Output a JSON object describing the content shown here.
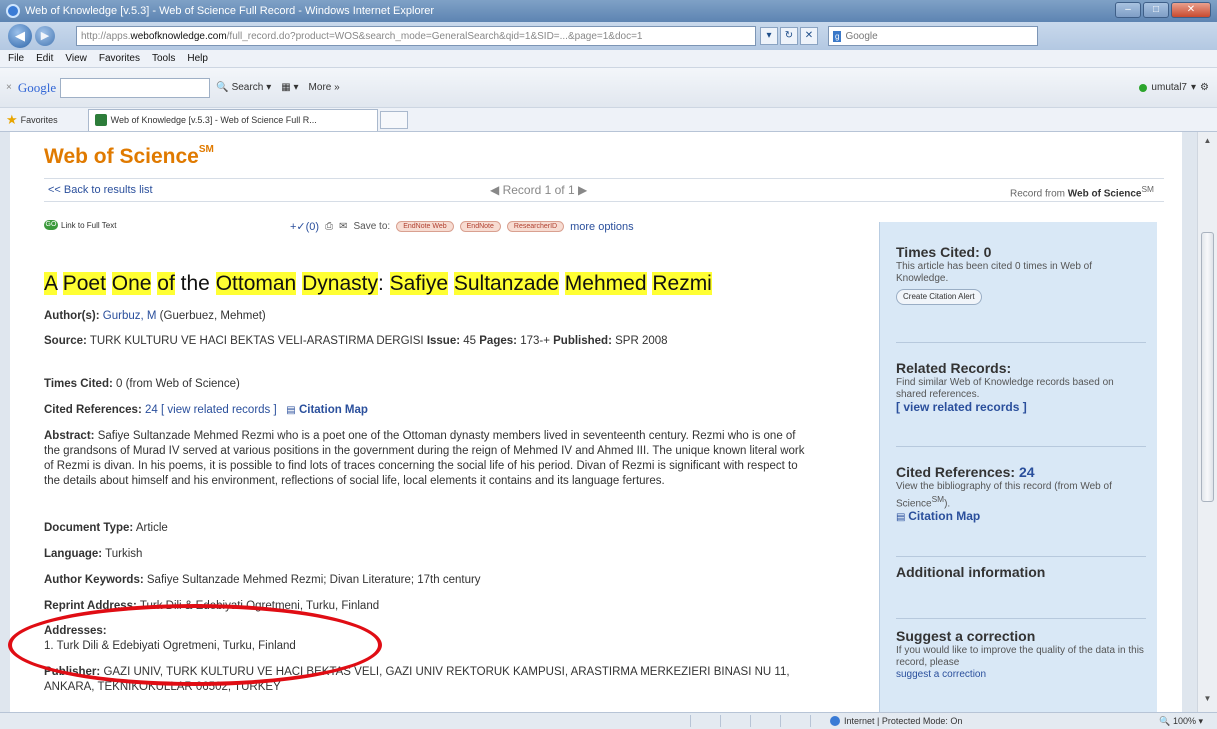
{
  "window": {
    "title": "Web of Knowledge [v.5.3] - Web of Science Full Record - Windows Internet Explorer"
  },
  "addressbar": {
    "url_prefix": "http://apps.",
    "url_domain": "webofknowledge.com",
    "url_rest": "/full_record.do?product=WOS&search_mode=GeneralSearch&qid=1&SID=...&page=1&doc=1",
    "search_engine": "Google"
  },
  "menu": [
    "File",
    "Edit",
    "View",
    "Favorites",
    "Tools",
    "Help"
  ],
  "google_toolbar": {
    "close": "×",
    "label": "Google",
    "search_label": "Search",
    "more_label": "More »",
    "user": "umutal7"
  },
  "favorites": {
    "label": "Favorites",
    "tab_title": "Web of Knowledge [v.5.3] - Web of Science Full R..."
  },
  "page": {
    "logo": "Web of Science",
    "logo_mark": "SM",
    "back": "<< Back to results list",
    "record_nav": "Record 1 of 1",
    "record_from_prefix": "Record from",
    "record_from": "Web of Science",
    "record_from_mark": "SM",
    "full_text": "Link to Full Text",
    "marked": "(0)",
    "save_to": "Save to:",
    "save_targets": [
      "EndNote Web",
      "EndNote",
      "ResearcherID"
    ],
    "more_options": "more options"
  },
  "record": {
    "title_words": [
      "A",
      "Poet",
      "One",
      "of",
      "the",
      "Ottoman",
      "Dynasty",
      ":",
      "Safiye",
      "Sultanzade",
      "Mehmed",
      "Rezmi"
    ],
    "authors_label": "Author(s):",
    "author_link": "Gurbuz, M",
    "author_full": "(Guerbuez, Mehmet)",
    "source_label": "Source:",
    "source": "TURK KULTURU VE HACI BEKTAS VELI-ARASTIRMA DERGISI",
    "issue_label": "Issue:",
    "issue": "45",
    "pages_label": "Pages:",
    "pages": "173-+",
    "published_label": "Published:",
    "published": "SPR 2008",
    "times_cited_label": "Times Cited:",
    "times_cited": "0 (from Web of Science)",
    "cited_refs_label": "Cited References:",
    "cited_refs_count": "24",
    "view_related": "[ view related records ]",
    "citation_map": "Citation Map",
    "abstract_label": "Abstract:",
    "abstract": "Safiye Sultanzade Mehmed Rezmi who is a poet one of the Ottoman dynasty members lived in seventeenth century. Rezmi who is one of the grandsons of Murad IV served at various positions in the government during the reign of Mehmed IV and Ahmed III. The unique known literal work of Rezmi is divan. In his poems, it is possible to find lots of traces concerning the social life of his period. Divan of Rezmi is significant with respect to the details about himself and his environment, reflections of social life, local elements it contains and its language fertures.",
    "doctype_label": "Document Type:",
    "doctype": "Article",
    "language_label": "Language:",
    "language": "Turkish",
    "keywords_label": "Author Keywords:",
    "keywords": "Safiye Sultanzade Mehmed Rezmi; Divan Literature; 17th century",
    "reprint_label": "Reprint Address:",
    "reprint": "Turk Dili & Edebiyati Ogretmeni, Turku, Finland",
    "addresses_label": "Addresses:",
    "address_1": "1. Turk Dili & Edebiyati Ogretmeni, Turku, Finland",
    "publisher_label": "Publisher:",
    "publisher": "GAZI UNIV, TURK KULTURU VE HACI BEKTAS VELI, GAZI UNIV REKTORUK KAMPUSI, ARASTIRMA MERKEZIERI BINASI NU 11, ANKARA, TEKNIKOKULLAR 06502, TURKEY"
  },
  "sidebar": {
    "times_cited_title": "Times Cited:",
    "times_cited_value": "0",
    "times_cited_desc": "This article has been cited 0 times in Web of Knowledge.",
    "alert_button": "Create Citation Alert",
    "related_title": "Related Records:",
    "related_desc": "Find similar Web of Knowledge records based on shared references.",
    "related_link": "[ view related records ]",
    "cited_title": "Cited References:",
    "cited_value": "24",
    "cited_desc": "View the bibliography of this record (from Web of Science",
    "cited_desc_mark": "SM",
    "cited_desc_end": ").",
    "citation_map": "Citation Map",
    "additional_title": "Additional information",
    "suggest_title": "Suggest a correction",
    "suggest_desc": "If you would like to improve the quality of the data in this record, please",
    "suggest_link": "suggest a correction"
  },
  "statusbar": {
    "zone": "Internet | Protected Mode: On",
    "zoom": "100%"
  },
  "colors": {
    "highlight": "#ffff33",
    "annotation": "#e00d14",
    "link": "#2a4f9c",
    "brand": "#e07a00"
  }
}
